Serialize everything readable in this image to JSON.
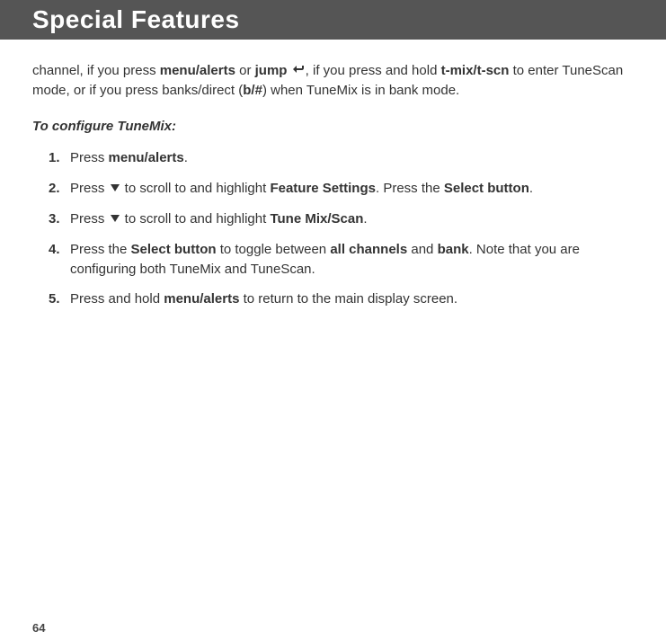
{
  "header": {
    "title": "Special Features"
  },
  "intro": {
    "p1a": "channel, if you press ",
    "p1b": "menu/alerts",
    "p1c": " or ",
    "p1d": "jump",
    "p1e": ", if you press and hold ",
    "p1f": "t-mix/t-scn",
    "p1g": " to enter TuneScan mode, or if you press banks/direct (",
    "p1h": "b/#",
    "p1i": ") when TuneMix is in bank mode."
  },
  "sub_heading": "To configure TuneMix:",
  "steps": [
    {
      "num": "1.",
      "a": "Press ",
      "b": "menu/alerts",
      "c": "."
    },
    {
      "num": "2.",
      "a": "Press ",
      "b": " to scroll to and highlight ",
      "c": "Feature Settings",
      "d": ". Press the ",
      "e": "Select button",
      "f": "."
    },
    {
      "num": "3.",
      "a": "Press ",
      "b": " to scroll to and highlight ",
      "c": "Tune Mix/Scan",
      "d": "."
    },
    {
      "num": "4.",
      "a": "Press the ",
      "b": "Select button",
      "c": " to toggle between ",
      "d": "all channels",
      "e": " and ",
      "f": "bank",
      "g": ". Note that you are configuring both TuneMix and TuneScan."
    },
    {
      "num": "5.",
      "a": "Press and hold ",
      "b": "menu/alerts",
      "c": " to return to the main display screen."
    }
  ],
  "page_number": "64"
}
